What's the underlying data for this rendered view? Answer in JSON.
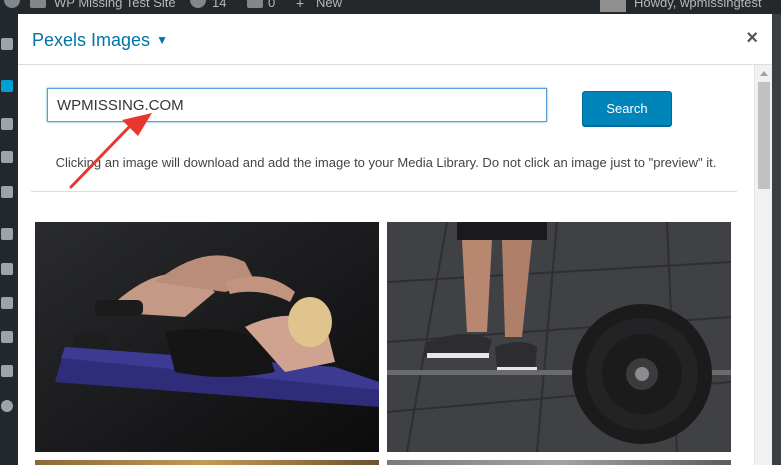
{
  "adminbar": {
    "site_name": "WP Missing Test Site",
    "comments_count": "14",
    "updates_count": "0",
    "new_label": "New",
    "howdy": "Howdy, wpmissingtest"
  },
  "modal": {
    "title": "Pexels Images",
    "close_symbol": "×"
  },
  "search": {
    "value": "WPMISSING.COM",
    "button_label": "Search"
  },
  "notice": "Clicking an image will download and add the image to your Media Library. Do not click an image just to \"preview\" it.",
  "colors": {
    "accent": "#0073aa",
    "button": "#0085ba",
    "annotation_arrow": "#e8382e"
  },
  "icons": {
    "sidebar": [
      "dashboard-icon",
      "pin-icon",
      "media-icon",
      "pages-icon",
      "comments-icon",
      "appearance-icon",
      "plugins-icon",
      "users-icon",
      "tools-icon",
      "settings-icon",
      "collapse-icon"
    ]
  }
}
